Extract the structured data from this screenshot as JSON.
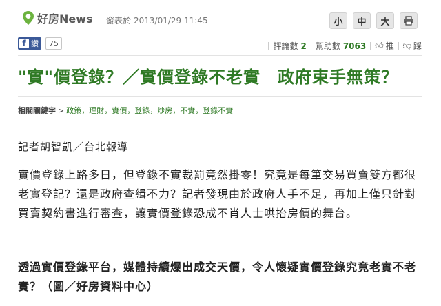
{
  "brand": {
    "name": "好房News"
  },
  "publish": {
    "label": "發表於",
    "datetime": "2013/01/29 11:45"
  },
  "font_size_buttons": {
    "small": "小",
    "medium": "中",
    "large": "大"
  },
  "print_icon": "printer-icon",
  "facebook": {
    "label": "讚",
    "count": "75"
  },
  "stats": {
    "comments_label": "評論數",
    "comments_value": "2",
    "helps_label": "幫助數",
    "helps_value": "7063",
    "recommend_label": "推",
    "disapprove_label": "踩"
  },
  "headline": "\"實\"價登錄？／實價登錄不老實　政府束手無策？",
  "keywords": {
    "label": "相關關鍵字",
    "arrow": ">",
    "items": "政策，理財，實價，登錄，炒房，不實，登錄不實"
  },
  "byline": "記者胡智凱／台北報導",
  "paragraph": "實價登錄上路多日，但登錄不實裁罰竟然掛零！究竟是每筆交易買賣雙方都很老實登記？還是政府查緝不力？記者發現由於政府人手不足，再加上僅只針對買賣契約書進行審查，讓實價登錄恐成不肖人士哄抬房價的舞台。",
  "caption": "透過實價登錄平台，媒體持續爆出成交天價，令人懷疑實價登錄究竟老實不老實？（圖／好房資料中心）",
  "colors": {
    "accent": "#2f7a25",
    "facebook": "#3b5998"
  }
}
